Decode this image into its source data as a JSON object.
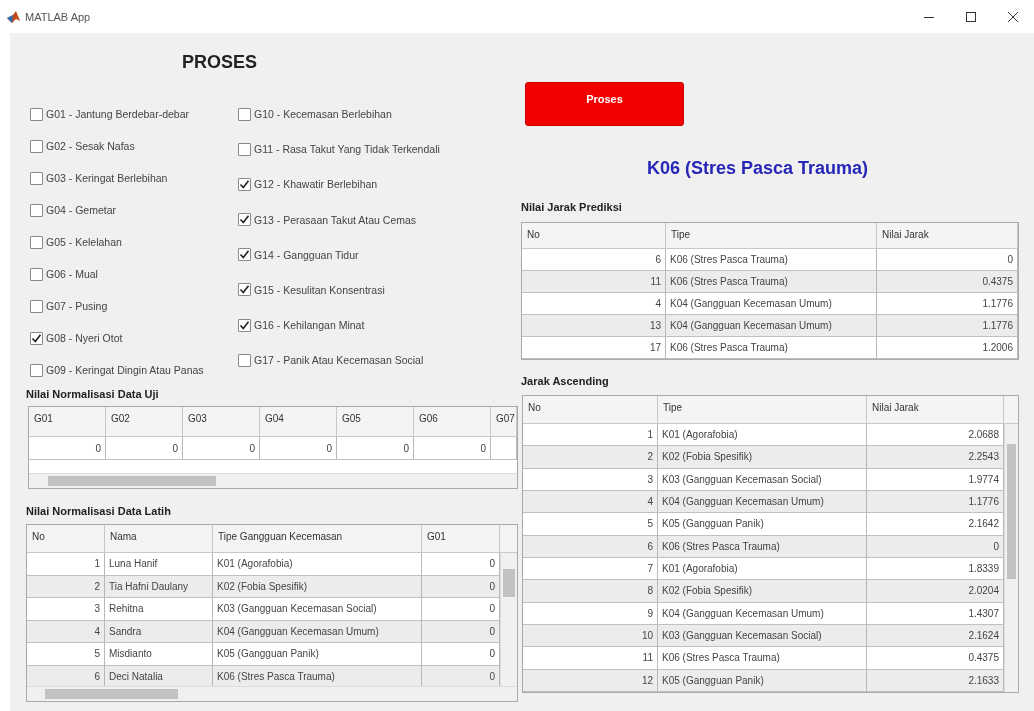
{
  "window": {
    "title": "MATLAB App"
  },
  "heading": "PROSES",
  "symptoms": [
    {
      "label": "G01 - Jantung Berdebar-debar",
      "checked": false
    },
    {
      "label": "G02 - Sesak Nafas",
      "checked": false
    },
    {
      "label": "G03 - Keringat Berlebihan",
      "checked": false
    },
    {
      "label": "G04 - Gemetar",
      "checked": false
    },
    {
      "label": "G05 - Kelelahan",
      "checked": false
    },
    {
      "label": "G06 - Mual",
      "checked": false
    },
    {
      "label": "G07 - Pusing",
      "checked": false
    },
    {
      "label": "G08 - Nyeri Otot",
      "checked": true
    },
    {
      "label": "G09 - Keringat Dingin Atau Panas",
      "checked": false
    },
    {
      "label": "G10 - Kecemasan Berlebihan",
      "checked": false
    },
    {
      "label": "G11 - Rasa Takut Yang Tidak Terkendali",
      "checked": false
    },
    {
      "label": "G12 - Khawatir Berlebihan",
      "checked": true
    },
    {
      "label": "G13 - Perasaan Takut Atau Cemas",
      "checked": true
    },
    {
      "label": "G14 - Gangguan Tidur",
      "checked": true
    },
    {
      "label": "G15 - Kesulitan Konsentrasi",
      "checked": true
    },
    {
      "label": "G16 - Kehilangan Minat",
      "checked": true
    },
    {
      "label": "G17 - Panik Atau Kecemasan Social",
      "checked": false
    }
  ],
  "process_button": "Proses",
  "result": "K06 (Stres Pasca Trauma)",
  "test_data": {
    "title": "Nilai Normalisasi Data Uji",
    "columns": [
      "G01",
      "G02",
      "G03",
      "G04",
      "G05",
      "G06",
      "G07"
    ],
    "rows": [
      [
        "0",
        "0",
        "0",
        "0",
        "0",
        "0"
      ]
    ]
  },
  "train_data": {
    "title": "Nilai Normalisasi Data Latih",
    "columns": [
      "No",
      "Nama",
      "Tipe Gangguan Kecemasan",
      "G01"
    ],
    "rows": [
      [
        "1",
        "Luna Hanif",
        "K01 (Agorafobia)",
        "0"
      ],
      [
        "2",
        "Tia Hafni Daulany",
        "K02 (Fobia Spesifik)",
        "0"
      ],
      [
        "3",
        "Rehitna",
        "K03 (Gangguan Kecemasan Social)",
        "0"
      ],
      [
        "4",
        "Sandra",
        "K04 (Gangguan Kecemasan Umum)",
        "0"
      ],
      [
        "5",
        "Misdianto",
        "K05 (Gangguan Panik)",
        "0"
      ],
      [
        "6",
        "Deci Natalia",
        "K06 (Stres Pasca Trauma)",
        "0"
      ]
    ]
  },
  "prediction": {
    "title": "Nilai Jarak Prediksi",
    "columns": [
      "No",
      "Tipe",
      "Nilai Jarak"
    ],
    "rows": [
      [
        "6",
        "K06 (Stres Pasca Trauma)",
        "0"
      ],
      [
        "11",
        "K06 (Stres Pasca Trauma)",
        "0.4375"
      ],
      [
        "4",
        "K04 (Gangguan Kecemasan Umum)",
        "1.1776"
      ],
      [
        "13",
        "K04 (Gangguan Kecemasan Umum)",
        "1.1776"
      ],
      [
        "17",
        "K06 (Stres Pasca Trauma)",
        "1.2006"
      ]
    ]
  },
  "ascending": {
    "title": "Jarak Ascending",
    "columns": [
      "No",
      "Tipe",
      "Nilai Jarak"
    ],
    "rows": [
      [
        "1",
        "K01 (Agorafobia)",
        "2.0688"
      ],
      [
        "2",
        "K02 (Fobia Spesifik)",
        "2.2543"
      ],
      [
        "3",
        "K03 (Gangguan Kecemasan Social)",
        "1.9774"
      ],
      [
        "4",
        "K04 (Gangguan Kecemasan Umum)",
        "1.1776"
      ],
      [
        "5",
        "K05 (Gangguan Panik)",
        "2.1642"
      ],
      [
        "6",
        "K06 (Stres Pasca Trauma)",
        "0"
      ],
      [
        "7",
        "K01 (Agorafobia)",
        "1.8339"
      ],
      [
        "8",
        "K02 (Fobia Spesifik)",
        "2.0204"
      ],
      [
        "9",
        "K04 (Gangguan Kecemasan Umum)",
        "1.4307"
      ],
      [
        "10",
        "K03 (Gangguan Kecemasan Social)",
        "2.1624"
      ],
      [
        "11",
        "K06 (Stres Pasca Trauma)",
        "0.4375"
      ],
      [
        "12",
        "K05 (Gangguan Panik)",
        "2.1633"
      ]
    ]
  }
}
